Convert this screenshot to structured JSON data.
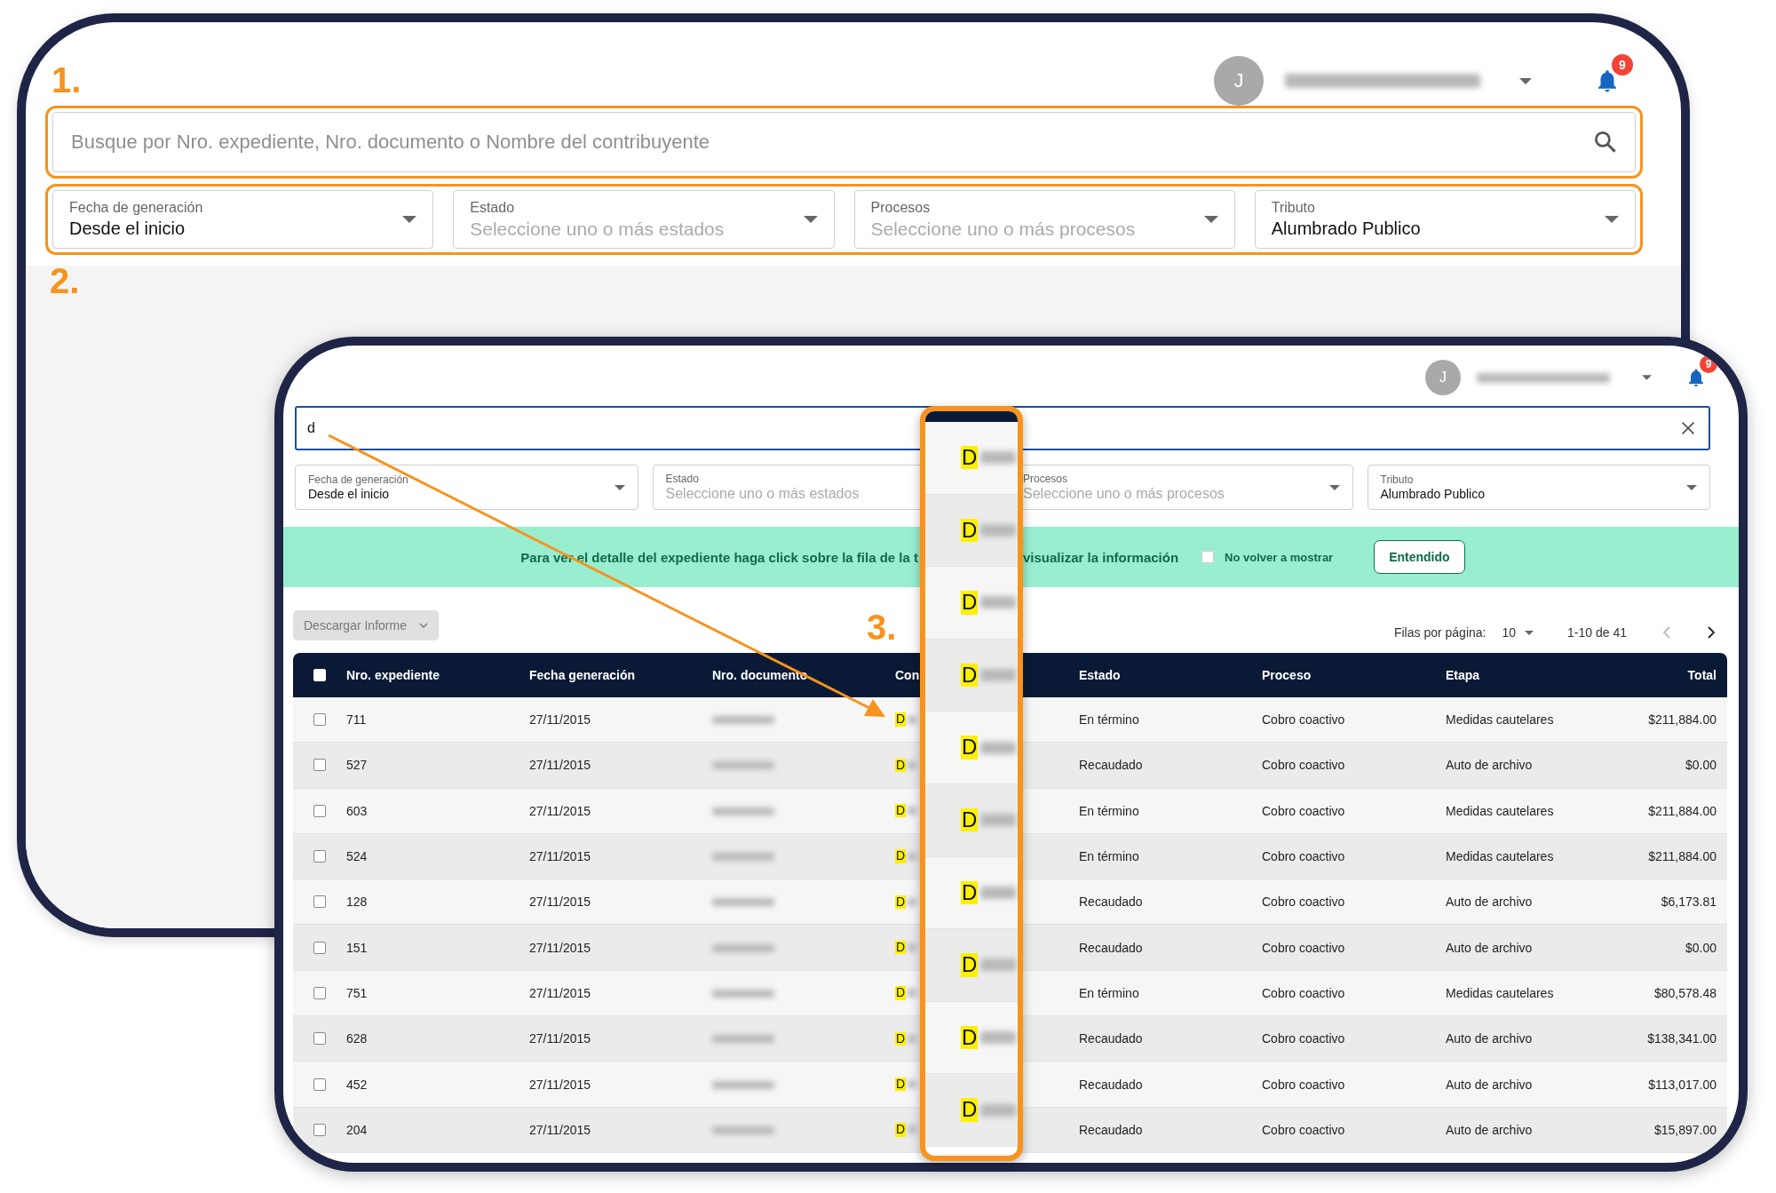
{
  "steps": [
    {
      "label": "1."
    },
    {
      "label": "2."
    },
    {
      "label": "3."
    }
  ],
  "screen_1": {
    "header": {
      "avatar_initial": "J",
      "notifications": "9"
    },
    "search": {
      "placeholder": "Busque por Nro. expediente, Nro. documento o Nombre del contribuyente"
    },
    "filters": [
      {
        "label": "Fecha de generación",
        "value": "Desde el inicio"
      },
      {
        "label": "Estado",
        "placeholder": "Seleccione uno o más estados"
      },
      {
        "label": "Procesos",
        "placeholder": "Seleccione uno o más procesos"
      },
      {
        "label": "Tributo",
        "value": "Alumbrado Publico"
      }
    ]
  },
  "screen_2": {
    "header": {
      "avatar_initial": "J",
      "notifications": "9"
    },
    "search": {
      "value": "d"
    },
    "filters": [
      {
        "label": "Fecha de generación",
        "value": "Desde el inicio"
      },
      {
        "label": "Estado",
        "placeholder": "Seleccione uno o más estados"
      },
      {
        "label": "Procesos",
        "placeholder": "Seleccione uno o más procesos"
      },
      {
        "label": "Tributo",
        "value": "Alumbrado Publico"
      }
    ],
    "banner": {
      "message_start": "Para ver el detalle del expediente haga click sobre la fila de la t",
      "message_end": "visualizar la información",
      "checkbox": {
        "label": "No volver a mostrar",
        "checked": false
      },
      "button": "Entendido"
    },
    "download_button": {
      "label": "Descargar Informe",
      "disabled": true
    },
    "pagination": {
      "rows_label": "Filas por página:",
      "rows_per_page": "10",
      "range": "1-10 de 41",
      "previous_disabled": true
    },
    "table": {
      "select_all": {
        "checked": false
      },
      "columns": [
        "Nro. expediente",
        "Fecha generación",
        "Nro. documento",
        "Con",
        "Estado",
        "Proceso",
        "Etapa",
        "Total"
      ],
      "rows": [
        {
          "checked": false,
          "expediente": "711",
          "fecha": "27/11/2015",
          "contribuyente": "D",
          "estado": "En término",
          "proceso": "Cobro coactivo",
          "etapa": "Medidas cautelares",
          "total": "$211,884.00"
        },
        {
          "checked": false,
          "expediente": "527",
          "fecha": "27/11/2015",
          "contribuyente": "D",
          "estado": "Recaudado",
          "proceso": "Cobro coactivo",
          "etapa": "Auto de archivo",
          "total": "$0.00"
        },
        {
          "checked": false,
          "expediente": "603",
          "fecha": "27/11/2015",
          "contribuyente": "D",
          "estado": "En término",
          "proceso": "Cobro coactivo",
          "etapa": "Medidas cautelares",
          "total": "$211,884.00"
        },
        {
          "checked": false,
          "expediente": "524",
          "fecha": "27/11/2015",
          "contribuyente": "D",
          "estado": "En término",
          "proceso": "Cobro coactivo",
          "etapa": "Medidas cautelares",
          "total": "$211,884.00"
        },
        {
          "checked": false,
          "expediente": "128",
          "fecha": "27/11/2015",
          "contribuyente": "D",
          "estado": "Recaudado",
          "proceso": "Cobro coactivo",
          "etapa": "Auto de archivo",
          "total": "$6,173.81"
        },
        {
          "checked": false,
          "expediente": "151",
          "fecha": "27/11/2015",
          "contribuyente": "D",
          "estado": "Recaudado",
          "proceso": "Cobro coactivo",
          "etapa": "Auto de archivo",
          "total": "$0.00"
        },
        {
          "checked": false,
          "expediente": "751",
          "fecha": "27/11/2015",
          "contribuyente": "D",
          "estado": "En término",
          "proceso": "Cobro coactivo",
          "etapa": "Medidas cautelares",
          "total": "$80,578.48"
        },
        {
          "checked": false,
          "expediente": "628",
          "fecha": "27/11/2015",
          "contribuyente": "D",
          "estado": "Recaudado",
          "proceso": "Cobro coactivo",
          "etapa": "Auto de archivo",
          "total": "$138,341.00"
        },
        {
          "checked": false,
          "expediente": "452",
          "fecha": "27/11/2015",
          "contribuyente": "D",
          "estado": "Recaudado",
          "proceso": "Cobro coactivo",
          "etapa": "Auto de archivo",
          "total": "$113,017.00"
        },
        {
          "checked": false,
          "expediente": "204",
          "fecha": "27/11/2015",
          "contribuyente": "D",
          "estado": "Recaudado",
          "proceso": "Cobro coactivo",
          "etapa": "Auto de archivo",
          "total": "$15,897.00"
        }
      ]
    }
  },
  "zoomed_column": {
    "cells": [
      "D",
      "D",
      "D",
      "D",
      "D",
      "D",
      "D",
      "D",
      "D",
      "D"
    ]
  }
}
